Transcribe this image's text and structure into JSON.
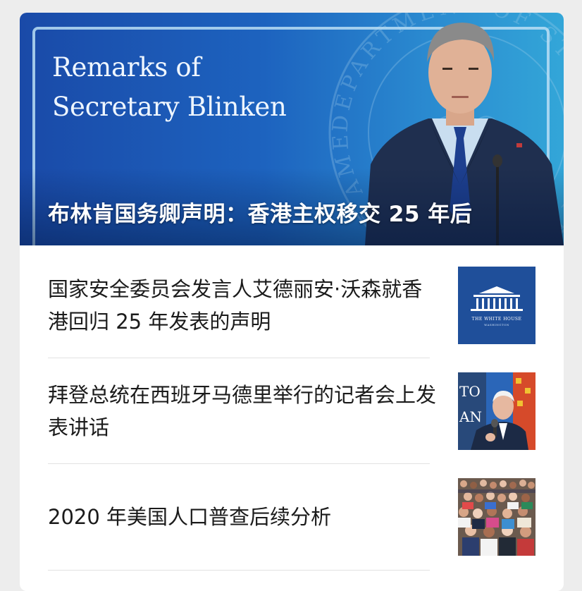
{
  "hero": {
    "title_line1": "Remarks of",
    "title_line2": "Secretary Blinken",
    "caption": "布林肯国务卿声明：香港主权移交 25 年后",
    "seal_text": "DEPARTMENT OF STATE · UNITED STATES OF AMERICA ·"
  },
  "articles": [
    {
      "title": "国家安全委员会发言人艾德丽安·沃森就香港回归 25 年发表的声明",
      "thumb_label": "THE WHITE HOUSE",
      "thumb_sublabel": "WASHINGTON"
    },
    {
      "title": "拜登总统在西班牙马德里举行的记者会上发表讲话",
      "thumb_sign_line1": "TO",
      "thumb_sign_line2": "AN"
    },
    {
      "title": "2020 年美国人口普查后续分析"
    }
  ],
  "colors": {
    "hero_left": "#1a4aa8",
    "hero_right": "#33a6d8",
    "white_house_bg": "#1f4f9a",
    "page_bg": "#ededed"
  }
}
